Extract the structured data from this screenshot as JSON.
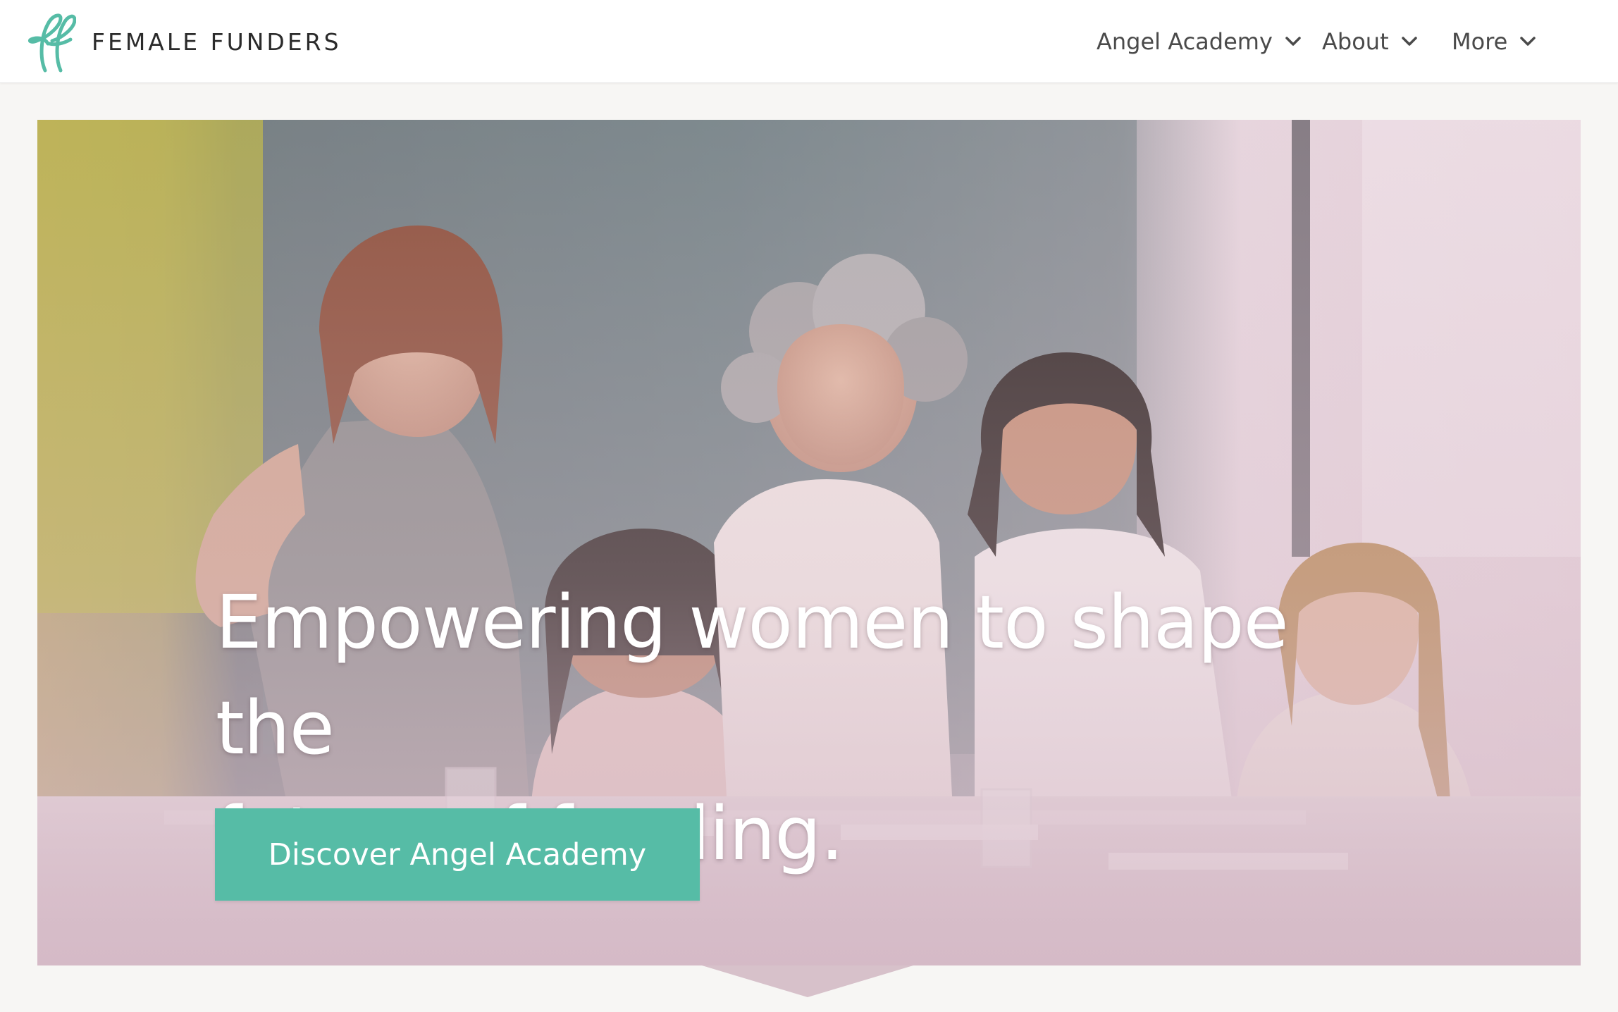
{
  "header": {
    "brand_name": "FEMALE FUNDERS",
    "logo_icon": "ff-script-logo-icon",
    "nav": [
      {
        "label": "Angel Academy",
        "icon": "chevron-down-icon"
      },
      {
        "label": "About",
        "icon": "chevron-down-icon"
      },
      {
        "label": "More",
        "icon": "chevron-down-icon"
      }
    ]
  },
  "hero": {
    "headline_line1": "Empowering women to shape the",
    "headline_line2": "future of funding.",
    "cta_label": "Discover Angel Academy"
  },
  "colors": {
    "brand_teal": "#56bca6",
    "hero_tint": "#d9c2cc",
    "text_dark": "#2b2b2b",
    "nav_text": "#4a4a4a",
    "page_bg": "#f7f6f4"
  }
}
